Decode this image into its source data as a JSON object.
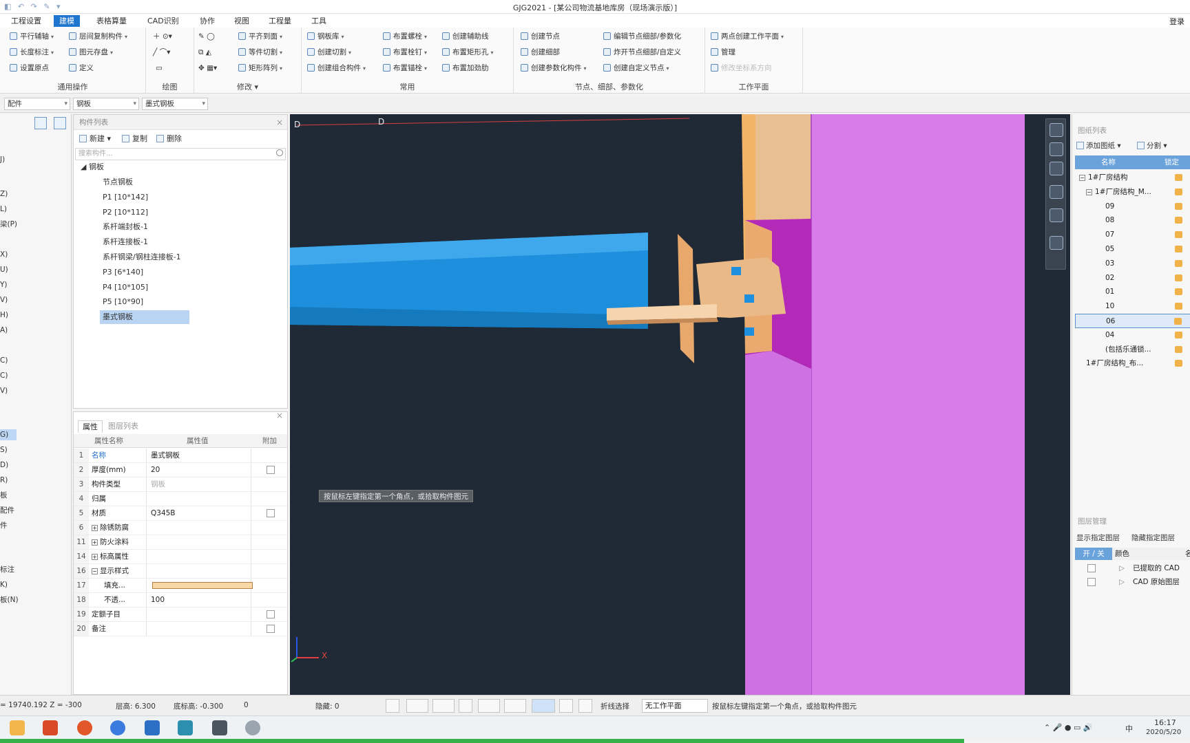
{
  "window": {
    "title": "GJG2021 - [某公司物流基地库房（现场演示版）]",
    "login": "登录"
  },
  "menu": {
    "tabs": [
      "工程设置",
      "建模",
      "表格算量",
      "CAD识别",
      "协作",
      "视图",
      "工程量",
      "工具"
    ],
    "active_index": 1
  },
  "ribbon": {
    "groups": [
      {
        "label": "通用操作",
        "buttons": [
          "平行辅轴",
          "层间复制构件",
          "长度标注",
          "图元存盘",
          "设置原点",
          "定义"
        ]
      },
      {
        "label": "绘图",
        "buttons": []
      },
      {
        "label": "修改",
        "buttons": [
          "平齐到面",
          "等件切割",
          "矩形阵列"
        ]
      },
      {
        "label": "常用",
        "buttons": [
          "钢板库",
          "布置螺栓",
          "创建辅助线",
          "创建切割",
          "布置栓钉",
          "布置矩形孔",
          "创建组合构件",
          "布置锚栓",
          "布置加劲肋"
        ]
      },
      {
        "label": "节点、细部、参数化",
        "buttons": [
          "创建节点",
          "编辑节点细部/参数化",
          "创建细部",
          "炸开节点细部/自定义",
          "创建参数化构件",
          "创建自定义节点"
        ]
      },
      {
        "label": "工作平面",
        "buttons": [
          "两点创建工作平面",
          "管理",
          "修改坐标系方向"
        ]
      }
    ]
  },
  "selectors": {
    "category": "配件",
    "type": "钢板",
    "item": "墨式钢板"
  },
  "left_nav": {
    "items": [
      "J)",
      "Z)",
      "L)",
      "梁(P)",
      "X)",
      "U)",
      "Y)",
      "V)",
      "H)",
      "A)",
      "C)",
      "C)",
      "V)",
      "G)",
      "S)",
      "D)",
      "R)",
      "板",
      "配件",
      "件",
      "标注",
      "K)",
      "板(N)"
    ],
    "active_index": 13
  },
  "component_list": {
    "title": "构件列表",
    "toolbar": {
      "new": "新建",
      "copy": "复制",
      "delete": "删除"
    },
    "search_placeholder": "搜索构件...",
    "root": "钢板",
    "items": [
      "节点钢板",
      "P1 [10*142]",
      "P2 [10*112]",
      "系杆端封板-1",
      "系杆连接板-1",
      "系杆钢梁/钢柱连接板-1",
      "P3 [6*140]",
      "P4 [10*105]",
      "P5 [10*90]",
      "墨式钢板"
    ],
    "selected_index": 9
  },
  "properties": {
    "tabs": [
      "属性",
      "图层列表"
    ],
    "headers": {
      "name": "属性名称",
      "value": "属性值",
      "add": "附加"
    },
    "rows": [
      {
        "num": "1",
        "name": "名称",
        "value": "墨式钢板",
        "check": false,
        "highlight": true
      },
      {
        "num": "2",
        "name": "厚度(mm)",
        "value": "20",
        "check": true
      },
      {
        "num": "3",
        "name": "构件类型",
        "value": "钢板",
        "check": false,
        "dim": true
      },
      {
        "num": "4",
        "name": "归属",
        "value": "",
        "check": false
      },
      {
        "num": "5",
        "name": "材质",
        "value": "Q345B",
        "check": true
      },
      {
        "num": "6",
        "name": "除锈防腐",
        "value": "",
        "expander": "+"
      },
      {
        "num": "11",
        "name": "防火涂料",
        "value": "",
        "expander": "+"
      },
      {
        "num": "14",
        "name": "标高属性",
        "value": "",
        "expander": "+"
      },
      {
        "num": "16",
        "name": "显示样式",
        "value": "",
        "expander": "−"
      },
      {
        "num": "17",
        "name": "填充...",
        "value": "",
        "swatch": true,
        "indent": true
      },
      {
        "num": "18",
        "name": "不透...",
        "value": "100",
        "indent": true
      },
      {
        "num": "19",
        "name": "定额子目",
        "value": "",
        "check": true
      },
      {
        "num": "20",
        "name": "备注",
        "value": "",
        "check": true
      }
    ],
    "fill_color": "#f8d7a8"
  },
  "viewport": {
    "axis_label_left": "D",
    "axis_label_mid": "D",
    "hint": "按鼠标左键指定第一个角点，或拾取构件图元",
    "axis_x": "X",
    "colors": {
      "background": "#1f2a36",
      "pipe": "#1e8fdc",
      "column": "#d77ce8",
      "plate": "#f2c49a"
    }
  },
  "drawing_list": {
    "title": "图纸列表",
    "toolbar": {
      "add": "添加图纸",
      "split": "分割"
    },
    "headers": {
      "name": "名称",
      "lock": "锁定"
    },
    "rows": [
      {
        "label": "1#厂房结构",
        "level": 0,
        "toggle": "−"
      },
      {
        "label": "1#厂房结构_M...",
        "level": 1,
        "toggle": "−"
      },
      {
        "label": "09",
        "level": 2
      },
      {
        "label": "08",
        "level": 2
      },
      {
        "label": "07",
        "level": 2
      },
      {
        "label": "05",
        "level": 2
      },
      {
        "label": "03",
        "level": 2
      },
      {
        "label": "02",
        "level": 2
      },
      {
        "label": "01",
        "level": 2
      },
      {
        "label": "10",
        "level": 2
      },
      {
        "label": "06",
        "level": 2,
        "active": true
      },
      {
        "label": "04",
        "level": 2
      },
      {
        "label": "(包括乐通锁...",
        "level": 2
      },
      {
        "label": "1#厂房结构_布...",
        "level": 1
      }
    ]
  },
  "layer_manager": {
    "title": "图层管理",
    "show_specified": "显示指定图层",
    "hide_specified": "隐藏指定图层",
    "headers": {
      "onoff": "开 / 关",
      "color": "颜色",
      "name": "名"
    },
    "rows": [
      {
        "label": "已提取的 CAD"
      },
      {
        "label": "CAD 原始图层"
      }
    ]
  },
  "statusbar": {
    "coords": "= 19740.192 Z = -300",
    "floor_height": "层高: 6.300",
    "bottom_elev": "底标高: -0.300",
    "zero": "0",
    "hidden": "隐藏: 0",
    "polyline_select": "折线选择",
    "workplane": "无工作平面",
    "hint": "按鼠标左键指定第一个角点，或拾取构件图元"
  },
  "taskbar": {
    "ime": "中",
    "time": "16:17",
    "date": "2020/5/20"
  }
}
